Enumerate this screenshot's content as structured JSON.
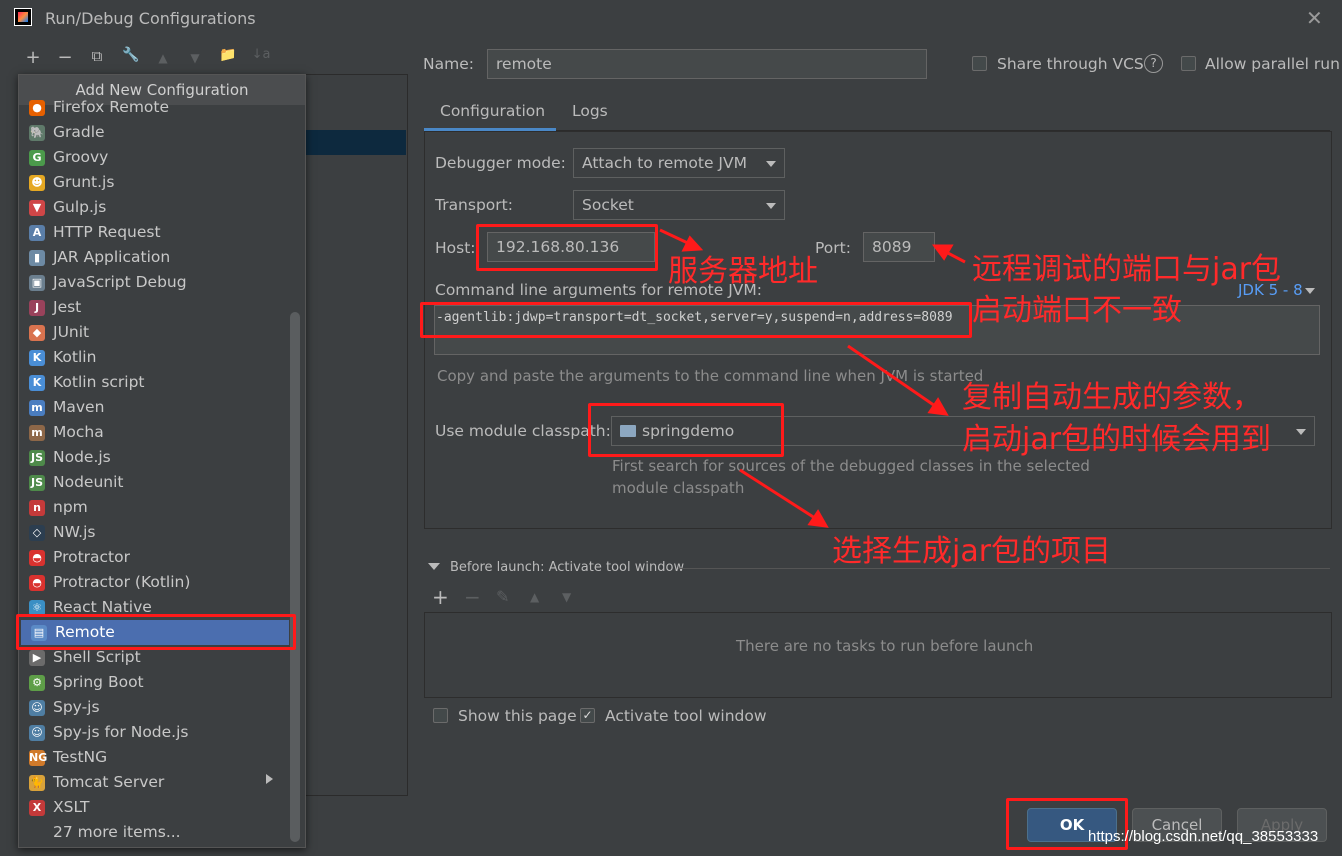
{
  "window": {
    "title": "Run/Debug Configurations"
  },
  "toolbar": {
    "add": "+",
    "remove": "−",
    "copy": "⧉",
    "wrench": "🔧",
    "up": "▲",
    "down": "▼",
    "folder": "📁",
    "sort": "↓a"
  },
  "popup": {
    "title": "Add New Configuration",
    "items": [
      {
        "label": "Firefox Remote",
        "icon": "firefox-icon",
        "color": "#e66000",
        "glyph": "●"
      },
      {
        "label": "Gradle",
        "icon": "gradle-icon",
        "color": "#5f7a6a",
        "glyph": "🐘"
      },
      {
        "label": "Groovy",
        "icon": "groovy-icon",
        "color": "#4b9a4b",
        "glyph": "G"
      },
      {
        "label": "Grunt.js",
        "icon": "grunt-icon",
        "color": "#e5a823",
        "glyph": "☻"
      },
      {
        "label": "Gulp.js",
        "icon": "gulp-icon",
        "color": "#cf4647",
        "glyph": "▼"
      },
      {
        "label": "HTTP Request",
        "icon": "http-request-icon",
        "color": "#5a7ea8",
        "glyph": "A"
      },
      {
        "label": "JAR Application",
        "icon": "jar-icon",
        "color": "#6d8aa4",
        "glyph": "▮"
      },
      {
        "label": "JavaScript Debug",
        "icon": "javascript-debug-icon",
        "color": "#6b7f8f",
        "glyph": "▣"
      },
      {
        "label": "Jest",
        "icon": "jest-icon",
        "color": "#99425b",
        "glyph": "J"
      },
      {
        "label": "JUnit",
        "icon": "junit-icon",
        "color": "#d9734f",
        "glyph": "◆"
      },
      {
        "label": "Kotlin",
        "icon": "kotlin-icon",
        "color": "#4a8ed6",
        "glyph": "K"
      },
      {
        "label": "Kotlin script",
        "icon": "kotlin-script-icon",
        "color": "#4a8ed6",
        "glyph": "K"
      },
      {
        "label": "Maven",
        "icon": "maven-icon",
        "color": "#4a7dc0",
        "glyph": "m"
      },
      {
        "label": "Mocha",
        "icon": "mocha-icon",
        "color": "#8d6748",
        "glyph": "m"
      },
      {
        "label": "Node.js",
        "icon": "nodejs-icon",
        "color": "#4e8a4a",
        "glyph": "JS"
      },
      {
        "label": "Nodeunit",
        "icon": "nodeunit-icon",
        "color": "#4e8a4a",
        "glyph": "JS"
      },
      {
        "label": "npm",
        "icon": "npm-icon",
        "color": "#c43a3a",
        "glyph": "n"
      },
      {
        "label": "NW.js",
        "icon": "nwjs-icon",
        "color": "#2c3e50",
        "glyph": "◇"
      },
      {
        "label": "Protractor",
        "icon": "protractor-icon",
        "color": "#d9322f",
        "glyph": "◓"
      },
      {
        "label": "Protractor (Kotlin)",
        "icon": "protractor-kotlin-icon",
        "color": "#d9322f",
        "glyph": "◓"
      },
      {
        "label": "React Native",
        "icon": "react-native-icon",
        "color": "#3a8fc4",
        "glyph": "⚛"
      },
      {
        "label": "Remote",
        "icon": "remote-icon",
        "color": "#5b8ac6",
        "glyph": "▤"
      },
      {
        "label": "Shell Script",
        "icon": "shell-script-icon",
        "color": "#6b6b6b",
        "glyph": "▶"
      },
      {
        "label": "Spring Boot",
        "icon": "spring-boot-icon",
        "color": "#5e9e48",
        "glyph": "⚙"
      },
      {
        "label": "Spy-js",
        "icon": "spy-js-icon",
        "color": "#4f7ea3",
        "glyph": "☺"
      },
      {
        "label": "Spy-js for Node.js",
        "icon": "spy-js-node-icon",
        "color": "#4f7ea3",
        "glyph": "☺"
      },
      {
        "label": "TestNG",
        "icon": "testng-icon",
        "color": "#d07a2b",
        "glyph": "NG"
      },
      {
        "label": "Tomcat Server",
        "icon": "tomcat-icon",
        "color": "#d9a23a",
        "glyph": "🐈"
      },
      {
        "label": "XSLT",
        "icon": "xslt-icon",
        "color": "#c43a3a",
        "glyph": "X"
      },
      {
        "label": "27 more items...",
        "icon": "",
        "color": "",
        "glyph": ""
      }
    ],
    "selected_label": "Remote"
  },
  "name": {
    "label": "Name:",
    "value": "remote"
  },
  "share_vcs": {
    "label": "Share through VCS",
    "help": "?"
  },
  "allow_parallel": {
    "label": "Allow parallel run"
  },
  "tabs": [
    {
      "label": "Configuration"
    },
    {
      "label": "Logs"
    }
  ],
  "config": {
    "debugger_mode": {
      "label": "Debugger mode:",
      "value": "Attach to remote JVM"
    },
    "transport": {
      "label": "Transport:",
      "value": "Socket"
    },
    "host": {
      "label": "Host:",
      "value": "192.168.80.136"
    },
    "port": {
      "label": "Port:",
      "value": "8089"
    },
    "cmd": {
      "label": "Command line arguments for remote JVM:",
      "jdk": "JDK 5 - 8",
      "value": "-agentlib:jdwp=transport=dt_socket,server=y,suspend=n,address=8089",
      "hint": "Copy and paste the arguments to the command line when JVM is started"
    },
    "module": {
      "label": "Use module classpath:",
      "value": "springdemo",
      "hint_line1": "First search for sources of the debugged classes in the selected",
      "hint_line2": "module classpath"
    }
  },
  "before_launch": {
    "title": "Before launch: Activate tool window",
    "empty_text": "There are no tasks to run before launch"
  },
  "show_page": {
    "label": "Show this page"
  },
  "activate_tool": {
    "label": "Activate tool window"
  },
  "buttons": {
    "ok": "OK",
    "cancel": "Cancel",
    "apply": "Apply"
  },
  "annotations": {
    "server_address": "服务器地址",
    "port_line1": "远程调试的端口与jar包",
    "port_line2": "启动端口不一致",
    "copy_line1": "复制自动生成的参数，",
    "copy_line2": "启动jar包的时候会用到",
    "select_project": "选择生成jar包的项目"
  },
  "watermark": "https://blog.csdn.net/qq_38553333",
  "colors": {
    "annotation_red": "#ff2a2a",
    "selection": "#4b6eaf",
    "tab_accent": "#4a88c7",
    "ok_button": "#365880"
  }
}
